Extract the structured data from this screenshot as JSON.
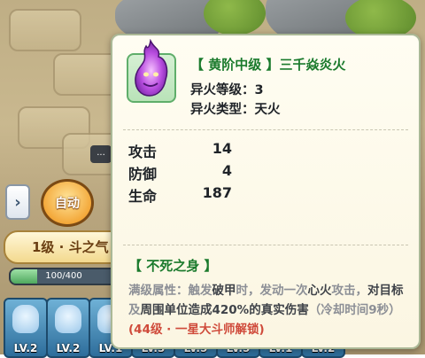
{
  "tooltip": {
    "name": "【 黄阶中级 】三千焱炎火",
    "level_line": "异火等级：3",
    "type_line": "异火类型：天火",
    "stats": [
      {
        "label": "攻击",
        "value": "14"
      },
      {
        "label": "防御",
        "value": "4"
      },
      {
        "label": "生命",
        "value": "187"
      }
    ],
    "skill_title": "【 不死之身 】",
    "skill_desc": {
      "k1": "满级属性：触发",
      "h1": "破甲",
      "k2": "时，发动一次",
      "h2": "心火",
      "k3": "攻击，",
      "h3": "对目标",
      "k4": "及",
      "h4": "周围单位造成420%的真实伤害",
      "k5": "（冷却时间9秒）",
      "r1": "(44级 · 一星大斗师解锁)"
    }
  },
  "hud": {
    "auto_label": "自动",
    "chat_icon": "...",
    "stage_label": "1级 · 斗之气",
    "hp_text": "100/400",
    "hp_progress": 0.25,
    "arrow": "›",
    "slots": [
      "LV.2",
      "LV.2",
      "LV.1",
      "LV.3",
      "LV.5",
      "LV.5",
      "LV.1",
      "LV.2"
    ]
  },
  "colors": {
    "name_green": "#1a7a2c",
    "unlock_red": "#cf4a3a",
    "panel_bg": "#fffdf2"
  }
}
